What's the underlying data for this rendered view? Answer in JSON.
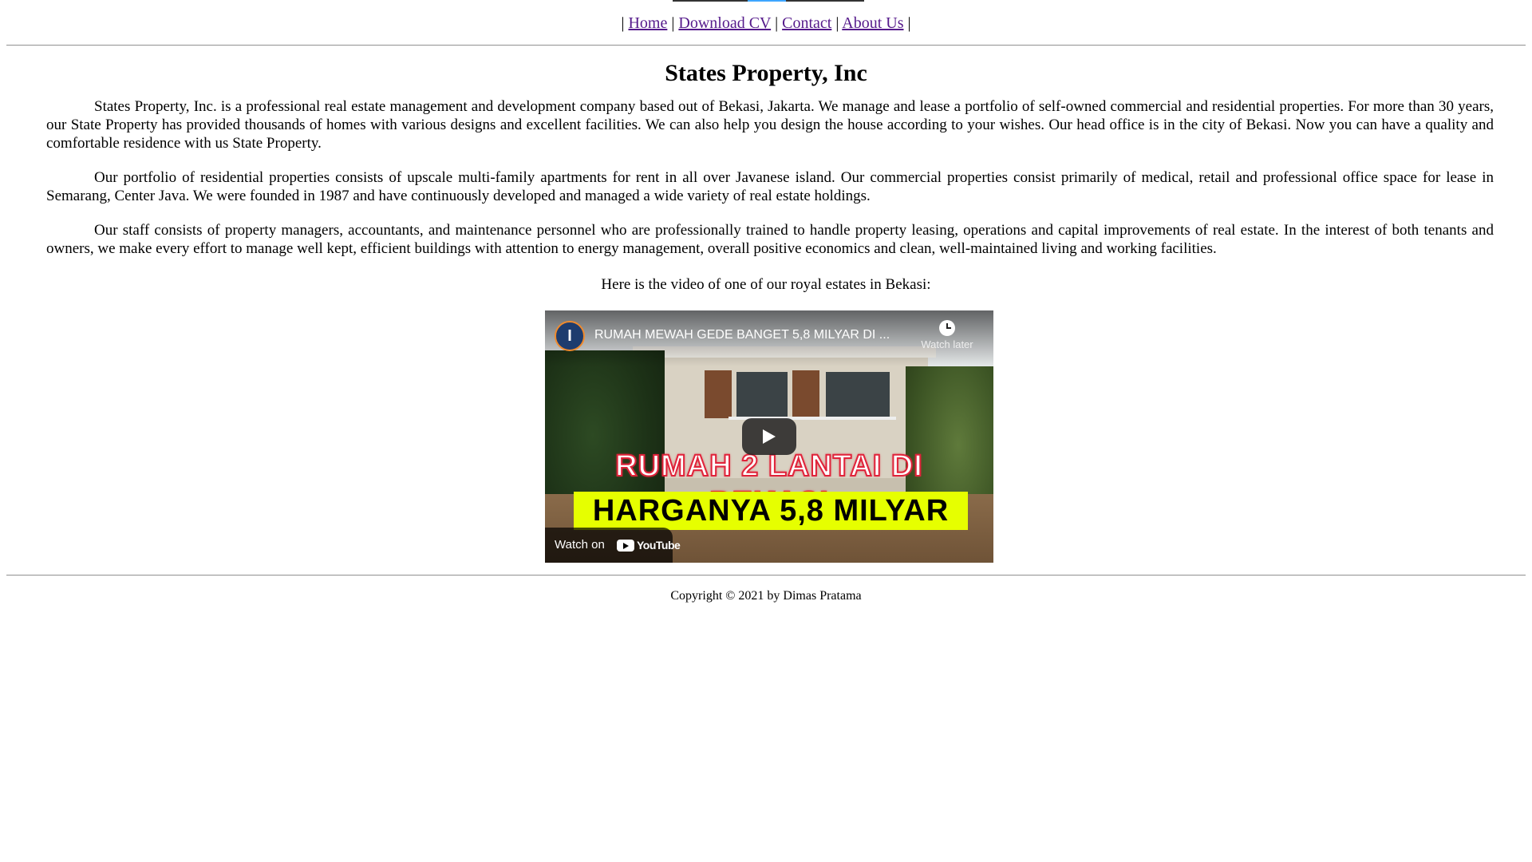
{
  "nav": {
    "separator": "|",
    "links": [
      "Home",
      "Download CV",
      "Contact",
      "About Us"
    ]
  },
  "page_title": "States Property, Inc",
  "paragraphs": [
    "States Property, Inc. is a professional real estate management and development company based out of Bekasi, Jakarta. We manage and lease a portfolio of self-owned commercial and residential properties. For more than 30 years, our State Property has provided thousands of homes with various designs and excellent facilities. We can also help you design the house according to your wishes. Our head office is in the city of Bekasi. Now you can have a quality and comfortable residence with us State Property.",
    "Our portfolio of residential properties consists of upscale multi-family apartments for rent in all over Javanese island. Our commercial properties consist primarily of medical, retail and professional office space for lease in Semarang, Center Java. We were founded in 1987 and have continuously developed and managed a wide variety of real estate holdings.",
    "Our staff consists of property managers, accountants, and maintenance personnel who are professionally trained to handle property leasing, operations and capital improvements of real estate. In the interest of both tenants and owners, we make every effort to manage well kept, efficient buildings with attention to energy management, overall positive economics and clean, well-maintained living and working facilities."
  ],
  "video_caption": "Here is the video of one of our royal estates in Bekasi:",
  "video": {
    "channel_initial": "I",
    "title": "RUMAH MEWAH GEDE BANGET 5,8 MILYAR DI ...",
    "watch_later": "Watch later",
    "thumbnail_line1": "RUMAH 2 LANTAI DI BEKASI",
    "thumbnail_line2": "HARGANYA 5,8 MILYAR",
    "watch_on": "Watch on",
    "youtube": "YouTube",
    "colors": {
      "thumbnail_red": "#e0233a",
      "thumbnail_yellow": "#e6ff00"
    }
  },
  "footer": {
    "copyright": "Copyright © 2021 by Dimas Pratama"
  },
  "colors": {
    "link": "#551a8b",
    "rule": "#9a9a9a"
  }
}
